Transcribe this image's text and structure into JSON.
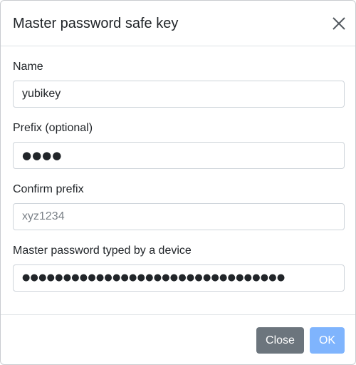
{
  "dialog": {
    "title": "Master password safe key"
  },
  "fields": {
    "name": {
      "label": "Name",
      "value": "yubikey"
    },
    "prefix": {
      "label": "Prefix (optional)",
      "masked_value": "●●●●"
    },
    "confirm_prefix": {
      "label": "Confirm prefix",
      "placeholder": "xyz1234",
      "value": ""
    },
    "master_password": {
      "label": "Master password typed by a device",
      "masked_value": "●●●●●●●●●●●●●●●●●●●●●●●●●●●●●●●●"
    }
  },
  "footer": {
    "close_label": "Close",
    "ok_label": "OK"
  },
  "colors": {
    "close_button": "#6c757d",
    "ok_button_disabled": "#7fb4fd",
    "border": "#dee2e6"
  },
  "icons": {
    "close": "close-icon"
  }
}
